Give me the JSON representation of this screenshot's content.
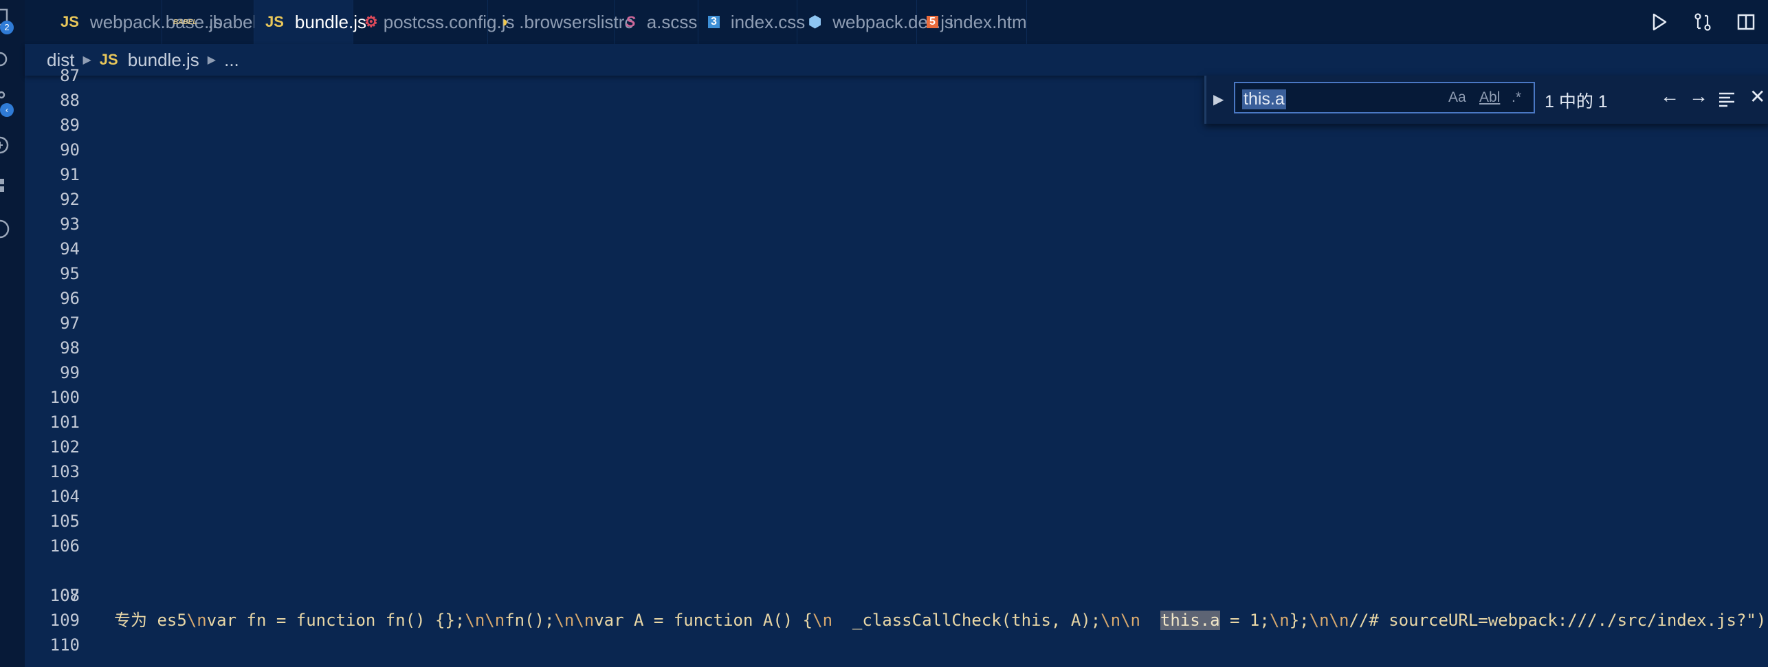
{
  "activity_bar": {
    "badges": [
      "2"
    ]
  },
  "tabs": [
    {
      "icon_text": "JS",
      "label": "webpack.base.js",
      "icon_color": "#e9c75a",
      "dirty": false,
      "active": false
    },
    {
      "icon_text": "BABEL",
      "label": ".babelrc",
      "icon_color": "#d9c48a",
      "dirty": false,
      "active": false
    },
    {
      "icon_text": "JS",
      "label": "bundle.js",
      "icon_color": "#e9c75a",
      "dirty": true,
      "active": true
    },
    {
      "icon_text": "⚙",
      "label": "postcss.config.js",
      "icon_color": "#dd4a5a",
      "dirty": false,
      "active": false
    },
    {
      "icon_text": "◑",
      "label": ".browserslistrc",
      "icon_color": "#f2c94c",
      "dirty": false,
      "active": false
    },
    {
      "icon_text": "S",
      "label": "a.scss",
      "icon_color": "#cd6799",
      "dirty": false,
      "active": false
    },
    {
      "icon_text": "3",
      "label": "index.css",
      "icon_color": "#3d8fd6",
      "dirty": true,
      "active": false
    },
    {
      "icon_text": "⬢",
      "label": "webpack.dev.js",
      "icon_color": "#8ec5f2",
      "dirty": false,
      "active": false
    },
    {
      "icon_text": "5",
      "label": "index.htm",
      "icon_color": "#e96b3c",
      "dirty": false,
      "active": false
    }
  ],
  "breadcrumb": {
    "folder": "dist",
    "file_icon": "JS",
    "file": "bundle.js",
    "more": "..."
  },
  "editor": {
    "lines": [
      {
        "num": "87",
        "code": ""
      },
      {
        "num": "88",
        "code": ""
      },
      {
        "num": "89",
        "code": ""
      },
      {
        "num": "90",
        "code": ""
      },
      {
        "num": "91",
        "code": ""
      },
      {
        "num": "92",
        "code": ""
      },
      {
        "num": "93",
        "code": ""
      },
      {
        "num": "94",
        "code": ""
      },
      {
        "num": "95",
        "code": ""
      },
      {
        "num": "96",
        "code": ""
      },
      {
        "num": "97",
        "code": ""
      },
      {
        "num": "98",
        "code": ""
      },
      {
        "num": "99",
        "code": ""
      },
      {
        "num": "100",
        "code": ""
      },
      {
        "num": "101",
        "code": ""
      },
      {
        "num": "102",
        "code": ""
      },
      {
        "num": "103",
        "code": ""
      },
      {
        "num": "104",
        "code": ""
      },
      {
        "num": "105",
        "code": ""
      },
      {
        "num": "106",
        "code": ""
      },
      {
        "num": "107",
        "code": ""
      },
      {
        "num": "108",
        "code": ""
      },
      {
        "num": "109",
        "code": ""
      },
      {
        "num": "110",
        "code": ""
      }
    ],
    "line_106": {
      "part1": "专为 es5",
      "esc1": "\\n",
      "part2": "var fn = function fn() {};",
      "esc2": "\\n\\n",
      "part3": "fn();",
      "esc3": "\\n\\n",
      "part4": "var A = function A() {",
      "esc4": "\\n",
      "part5": "  _classCallCheck(this, A);",
      "esc5": "\\n\\n",
      "part6": "  ",
      "match": "this.a",
      "part7": " = 1;",
      "esc6": "\\n",
      "part8": "};",
      "esc7": "\\n\\n",
      "part9": "//# sourceURL=webpack:///./src/index.js?\");"
    }
  },
  "find_widget": {
    "value": "this.a",
    "match_case": "Aa",
    "whole_word": "Abl",
    "regex": ".*",
    "count": "1 中的 1"
  }
}
